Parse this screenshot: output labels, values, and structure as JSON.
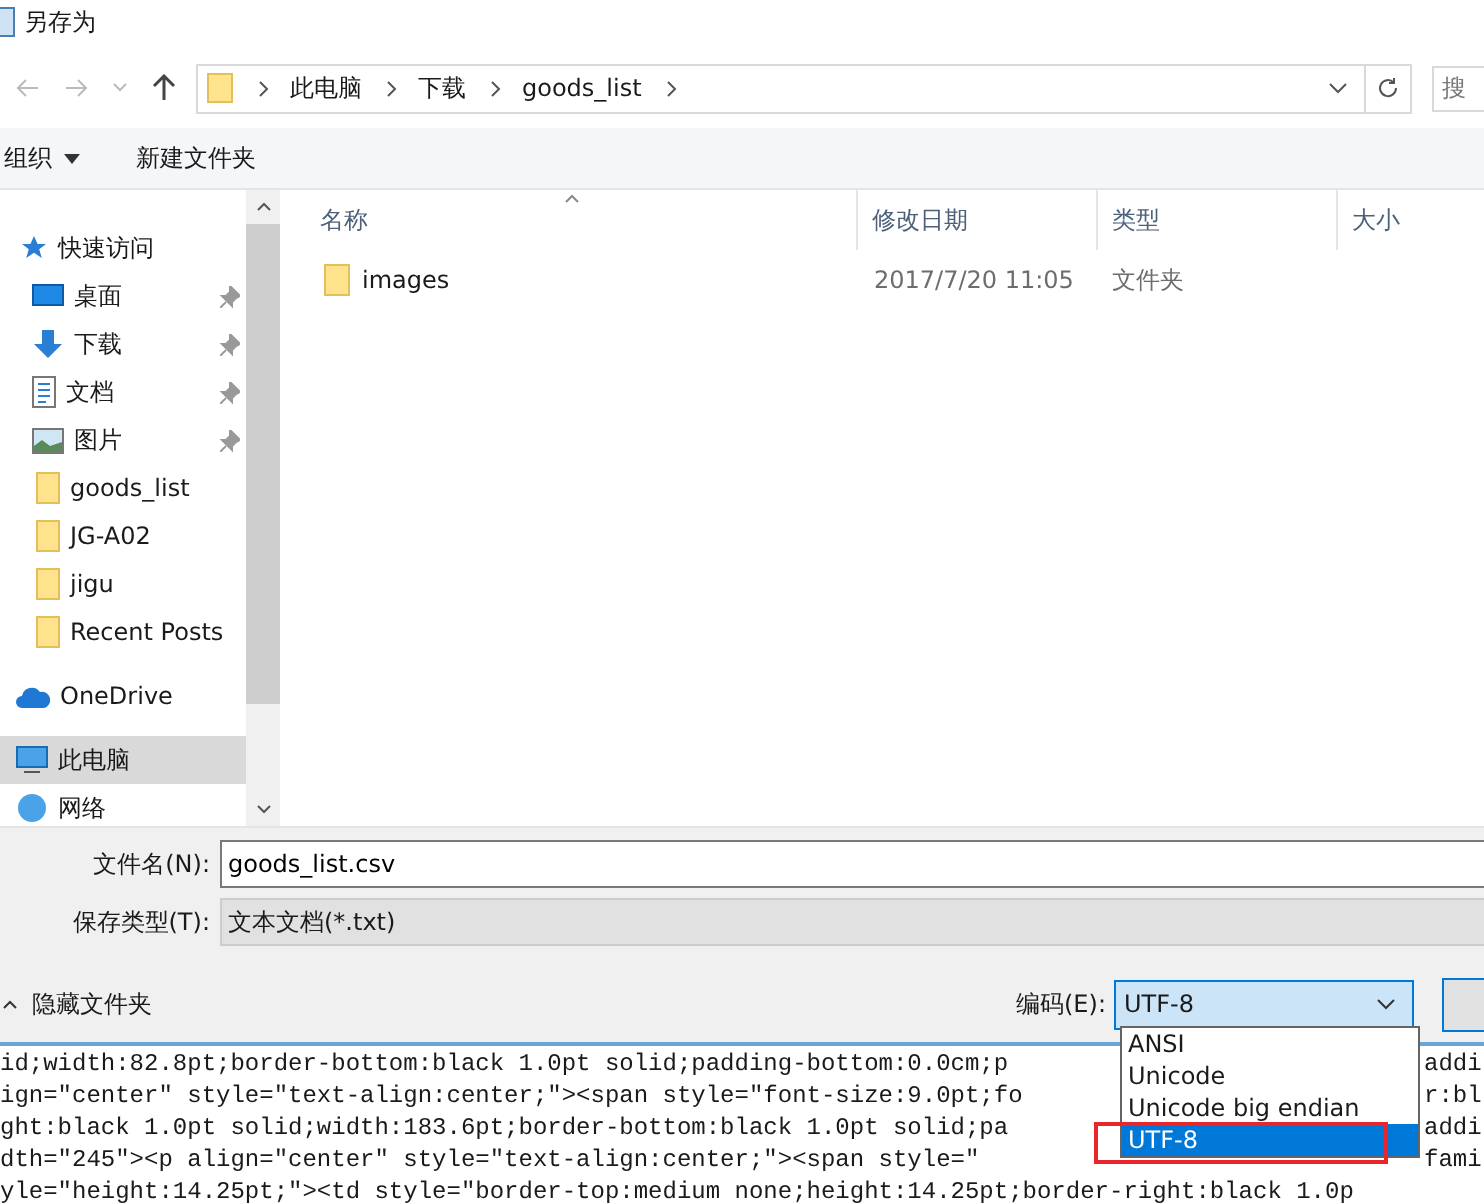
{
  "window": {
    "title": "另存为"
  },
  "nav": {
    "path": [
      "此电脑",
      "下载",
      "goods_list"
    ],
    "search_placeholder": "搜"
  },
  "toolbar": {
    "organize": "组织",
    "new_folder": "新建文件夹"
  },
  "sidebar": {
    "items": [
      {
        "label": "快速访问",
        "kind": "star",
        "pinned": false,
        "selected": false
      },
      {
        "label": "桌面",
        "kind": "desktop",
        "pinned": true,
        "selected": false
      },
      {
        "label": "下载",
        "kind": "download",
        "pinned": true,
        "selected": false
      },
      {
        "label": "文档",
        "kind": "document",
        "pinned": true,
        "selected": false
      },
      {
        "label": "图片",
        "kind": "picture",
        "pinned": true,
        "selected": false
      },
      {
        "label": "goods_list",
        "kind": "folder",
        "pinned": false,
        "selected": false
      },
      {
        "label": "JG-A02",
        "kind": "folder",
        "pinned": false,
        "selected": false
      },
      {
        "label": "jigu",
        "kind": "folder",
        "pinned": false,
        "selected": false
      },
      {
        "label": "Recent Posts",
        "kind": "folder",
        "pinned": false,
        "selected": false
      },
      {
        "label": "OneDrive",
        "kind": "cloud",
        "pinned": false,
        "selected": false
      },
      {
        "label": "此电脑",
        "kind": "computer",
        "pinned": false,
        "selected": true
      },
      {
        "label": "网络",
        "kind": "network",
        "pinned": false,
        "selected": false
      }
    ]
  },
  "table": {
    "columns": [
      "名称",
      "修改日期",
      "类型",
      "大小"
    ],
    "rows": [
      {
        "name": "images",
        "modified": "2017/7/20 11:05",
        "type": "文件夹"
      }
    ]
  },
  "form": {
    "filename_label": "文件名(N):",
    "filename": "goods_list.csv",
    "type_label": "保存类型(T):",
    "type_value": "文本文档(*.txt)"
  },
  "footer": {
    "hide_folders": "隐藏文件夹",
    "encoding_label": "编码(E):",
    "encoding_value": "UTF-8",
    "options": [
      {
        "label": "ANSI",
        "selected": false
      },
      {
        "label": "Unicode",
        "selected": false
      },
      {
        "label": "Unicode big endian",
        "selected": false
      },
      {
        "label": "UTF-8",
        "selected": true
      }
    ]
  },
  "background_code": [
    {
      "left": "id;width:82.8pt;border-bottom:black 1.0pt solid;padding-bottom:0.0cm;p",
      "right": "addi"
    },
    {
      "left": "ign=\"center\" style=\"text-align:center;\"><span style=\"font-size:9.0pt;fo",
      "right": "r:bl"
    },
    {
      "left": "ght:black 1.0pt solid;width:183.6pt;border-bottom:black 1.0pt solid;pa",
      "right": "addi"
    },
    {
      "left": "dth=\"245\"><p align=\"center\" style=\"text-align:center;\"><span style=\"",
      "right": "fami"
    },
    {
      "left": "yle=\"height:14.25pt;\"><td style=\"border-top:medium none;height:14.25pt;border-right:black 1.0p"
    }
  ]
}
